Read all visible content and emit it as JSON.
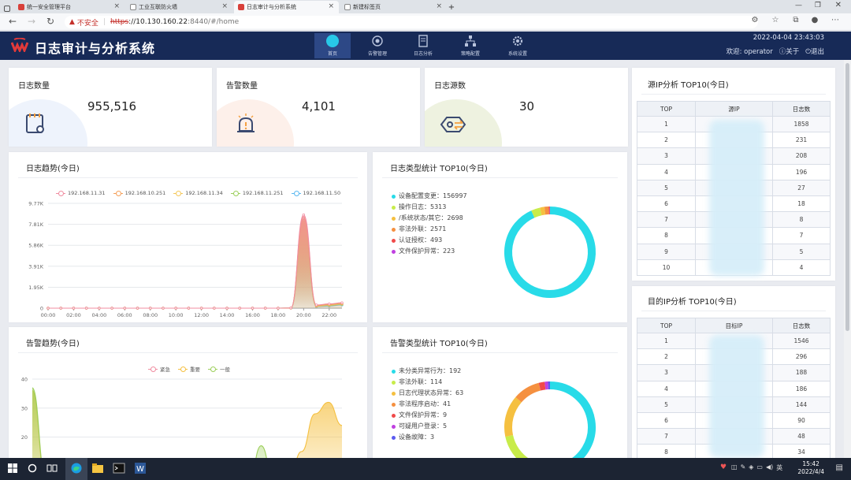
{
  "browser": {
    "tabs": [
      {
        "label": "统一安全管理平台",
        "active": false
      },
      {
        "label": "工业互联防火墙",
        "active": false
      },
      {
        "label": "日志审计与分析系统",
        "active": true
      },
      {
        "label": "新建标签页",
        "active": false
      }
    ],
    "new_tab": "+",
    "security_label": "不安全",
    "url_protocol": "https",
    "url_host": "://10.130.160.22",
    "url_path": ":8440/#/home"
  },
  "app": {
    "title": "日志审计与分析系统",
    "nav": [
      {
        "label": "首页",
        "icon": "home-icon",
        "active": true
      },
      {
        "label": "告警管理",
        "icon": "alarm-icon"
      },
      {
        "label": "日志分析",
        "icon": "log-analysis-icon"
      },
      {
        "label": "策略配置",
        "icon": "policy-icon"
      },
      {
        "label": "系统设置",
        "icon": "settings-icon"
      }
    ],
    "datetime": "2022-04-04 23:43:03",
    "welcome": "欢迎: operator",
    "about": "关于",
    "logout": "退出"
  },
  "stats": [
    {
      "title": "日志数量",
      "value": "955,516",
      "color": "#4a7fd8"
    },
    {
      "title": "告警数量",
      "value": "4,101",
      "color": "#e8734a"
    },
    {
      "title": "日志源数",
      "value": "30",
      "color": "#8da93a"
    }
  ],
  "log_trend": {
    "title": "日志趋势(今日)",
    "legend": [
      {
        "name": "192.168.11.31",
        "color": "#f08ca0"
      },
      {
        "name": "192.168.10.251",
        "color": "#f5a05a"
      },
      {
        "name": "192.168.11.34",
        "color": "#f5c85a"
      },
      {
        "name": "192.168.11.251",
        "color": "#9ccf5a"
      },
      {
        "name": "192.168.11.50",
        "color": "#5ab8f0"
      }
    ]
  },
  "log_types": {
    "title": "日志类型统计 TOP10(今日)",
    "items": [
      {
        "label": "设备配置变更：156997",
        "color": "#28dbe8"
      },
      {
        "label": "操作日志：5313",
        "color": "#c8ec4a"
      },
      {
        "label": "/系统状态/其它：2698",
        "color": "#f5c040"
      },
      {
        "label": "非法外联：2571",
        "color": "#f59040"
      },
      {
        "label": "认证授权：493",
        "color": "#f04a4a"
      },
      {
        "label": "文件保护异常：223",
        "color": "#c040e0"
      }
    ]
  },
  "alarm_trend": {
    "title": "告警趋势(今日)",
    "legend": [
      {
        "name": "紧急",
        "color": "#f08ca0"
      },
      {
        "name": "重要",
        "color": "#f5c040"
      },
      {
        "name": "一般",
        "color": "#9ccf5a"
      }
    ]
  },
  "alarm_types": {
    "title": "告警类型统计 TOP10(今日)",
    "items": [
      {
        "label": "未分类异常行为：192",
        "color": "#28dbe8"
      },
      {
        "label": "非法外联：114",
        "color": "#c8ec4a"
      },
      {
        "label": "日志代理状态异常：63",
        "color": "#f5c040"
      },
      {
        "label": "非法程序启动：41",
        "color": "#f59040"
      },
      {
        "label": "文件保护异常：9",
        "color": "#f04a4a"
      },
      {
        "label": "可疑用户登录：5",
        "color": "#c040e0"
      },
      {
        "label": "设备故障：3",
        "color": "#5a5af0"
      }
    ]
  },
  "src_ip": {
    "title": "源IP分析 TOP10(今日)",
    "headers": [
      "TOP",
      "源IP",
      "日志数"
    ],
    "rows": [
      {
        "top": "1",
        "count": "1858"
      },
      {
        "top": "2",
        "count": "231"
      },
      {
        "top": "3",
        "count": "208"
      },
      {
        "top": "4",
        "count": "196"
      },
      {
        "top": "5",
        "count": "27"
      },
      {
        "top": "6",
        "count": "18"
      },
      {
        "top": "7",
        "count": "8"
      },
      {
        "top": "8",
        "count": "7"
      },
      {
        "top": "9",
        "count": "5"
      },
      {
        "top": "10",
        "count": "4"
      }
    ]
  },
  "dst_ip": {
    "title": "目的IP分析 TOP10(今日)",
    "headers": [
      "TOP",
      "目标IP",
      "日志数"
    ],
    "rows": [
      {
        "top": "1",
        "count": "1546"
      },
      {
        "top": "2",
        "count": "296"
      },
      {
        "top": "3",
        "count": "188"
      },
      {
        "top": "4",
        "count": "186"
      },
      {
        "top": "5",
        "count": "144"
      },
      {
        "top": "6",
        "count": "90"
      },
      {
        "top": "7",
        "count": "48"
      },
      {
        "top": "8",
        "count": "34"
      }
    ]
  },
  "taskbar": {
    "time": "15:42",
    "date": "2022/4/4",
    "ime": "英"
  },
  "chart_data": [
    {
      "type": "area",
      "title": "日志趋势(今日)",
      "x_ticks": [
        "00:00",
        "02:00",
        "04:00",
        "06:00",
        "08:00",
        "10:00",
        "12:00",
        "14:00",
        "16:00",
        "18:00",
        "20:00",
        "22:00"
      ],
      "y_ticks": [
        "0",
        "1.95K",
        "3.91K",
        "5.86K",
        "7.81K",
        "9.77K"
      ],
      "ylim": [
        0,
        9770
      ],
      "x": [
        0,
        1,
        2,
        3,
        4,
        5,
        6,
        7,
        8,
        9,
        10,
        11,
        12,
        13,
        14,
        15,
        16,
        17,
        18,
        19,
        20,
        21,
        22,
        23
      ],
      "series": [
        {
          "name": "192.168.11.31",
          "values": [
            0,
            0,
            0,
            0,
            0,
            0,
            0,
            0,
            0,
            0,
            0,
            0,
            0,
            0,
            0,
            0,
            0,
            0,
            0,
            20,
            8700,
            300,
            400,
            500
          ]
        },
        {
          "name": "192.168.10.251",
          "values": [
            0,
            0,
            0,
            0,
            0,
            0,
            0,
            0,
            0,
            0,
            0,
            0,
            0,
            0,
            0,
            0,
            0,
            0,
            0,
            10,
            8400,
            250,
            350,
            450
          ]
        },
        {
          "name": "192.168.11.34",
          "values": [
            0,
            0,
            0,
            0,
            0,
            0,
            0,
            0,
            0,
            0,
            0,
            0,
            0,
            0,
            0,
            0,
            0,
            0,
            0,
            10,
            8200,
            200,
            300,
            400
          ]
        },
        {
          "name": "192.168.11.251",
          "values": [
            0,
            0,
            0,
            0,
            0,
            0,
            0,
            0,
            0,
            0,
            0,
            0,
            0,
            0,
            0,
            0,
            0,
            0,
            0,
            10,
            8000,
            180,
            250,
            350
          ]
        },
        {
          "name": "192.168.11.50",
          "values": [
            0,
            0,
            0,
            0,
            0,
            0,
            0,
            0,
            0,
            0,
            0,
            0,
            0,
            0,
            0,
            0,
            0,
            0,
            0,
            10,
            7800,
            150,
            200,
            300
          ]
        }
      ]
    },
    {
      "type": "pie",
      "title": "日志类型统计 TOP10(今日)",
      "categories": [
        "设备配置变更",
        "操作日志",
        "/系统状态/其它",
        "非法外联",
        "认证授权",
        "文件保护异常"
      ],
      "values": [
        156997,
        5313,
        2698,
        2571,
        493,
        223
      ]
    },
    {
      "type": "area",
      "title": "告警趋势(今日)",
      "y_ticks": [
        "10",
        "20",
        "30",
        "40"
      ],
      "ylim": [
        0,
        40
      ],
      "x": [
        0,
        1,
        2,
        3,
        4,
        5,
        6,
        7,
        8,
        9,
        10,
        11,
        12,
        13,
        14,
        15,
        16,
        17,
        18,
        19,
        20,
        21,
        22,
        23
      ],
      "series": [
        {
          "name": "紧急",
          "values": [
            0,
            0,
            0,
            0,
            0,
            0,
            0,
            0,
            0,
            0,
            0,
            0,
            0,
            0,
            0,
            0,
            0,
            0,
            0,
            0,
            0,
            0,
            0,
            0
          ]
        },
        {
          "name": "重要",
          "values": [
            36,
            5,
            3,
            2,
            2,
            3,
            6,
            9,
            4,
            3,
            6,
            3,
            2,
            8,
            12,
            3,
            3,
            12,
            4,
            4,
            15,
            28,
            32,
            24
          ]
        },
        {
          "name": "一般",
          "values": [
            37,
            6,
            3,
            2,
            2,
            2,
            3,
            3,
            2,
            2,
            3,
            2,
            2,
            3,
            5,
            2,
            2,
            17,
            3,
            2,
            4,
            6,
            8,
            6
          ]
        }
      ]
    },
    {
      "type": "pie",
      "title": "告警类型统计 TOP10(今日)",
      "categories": [
        "未分类异常行为",
        "非法外联",
        "日志代理状态异常",
        "非法程序启动",
        "文件保护异常",
        "可疑用户登录",
        "设备故障"
      ],
      "values": [
        192,
        114,
        63,
        41,
        9,
        5,
        3
      ]
    }
  ]
}
